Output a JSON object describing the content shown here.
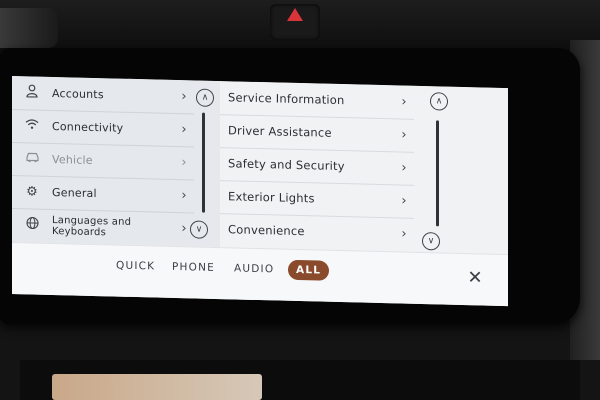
{
  "settings": {
    "left_menu": [
      {
        "label": "Accounts",
        "icon": "person-icon"
      },
      {
        "label": "Connectivity",
        "icon": "wifi-icon"
      },
      {
        "label": "Vehicle",
        "icon": "car-icon",
        "selected": true
      },
      {
        "label": "General",
        "icon": "gear-icon"
      },
      {
        "label": "Languages and Keyboards",
        "icon": "globe-icon"
      }
    ],
    "right_menu": [
      {
        "label": "Service Information"
      },
      {
        "label": "Driver Assistance"
      },
      {
        "label": "Safety and Security"
      },
      {
        "label": "Exterior Lights"
      },
      {
        "label": "Convenience"
      }
    ]
  },
  "bottom_tabs": [
    {
      "label": "QUICK"
    },
    {
      "label": "PHONE"
    },
    {
      "label": "AUDIO"
    },
    {
      "label": "ALL",
      "active": true
    }
  ],
  "colors": {
    "accent": "#8a4a2c",
    "hazard": "#d8343a",
    "screen_bg": "#f4f5f7"
  }
}
